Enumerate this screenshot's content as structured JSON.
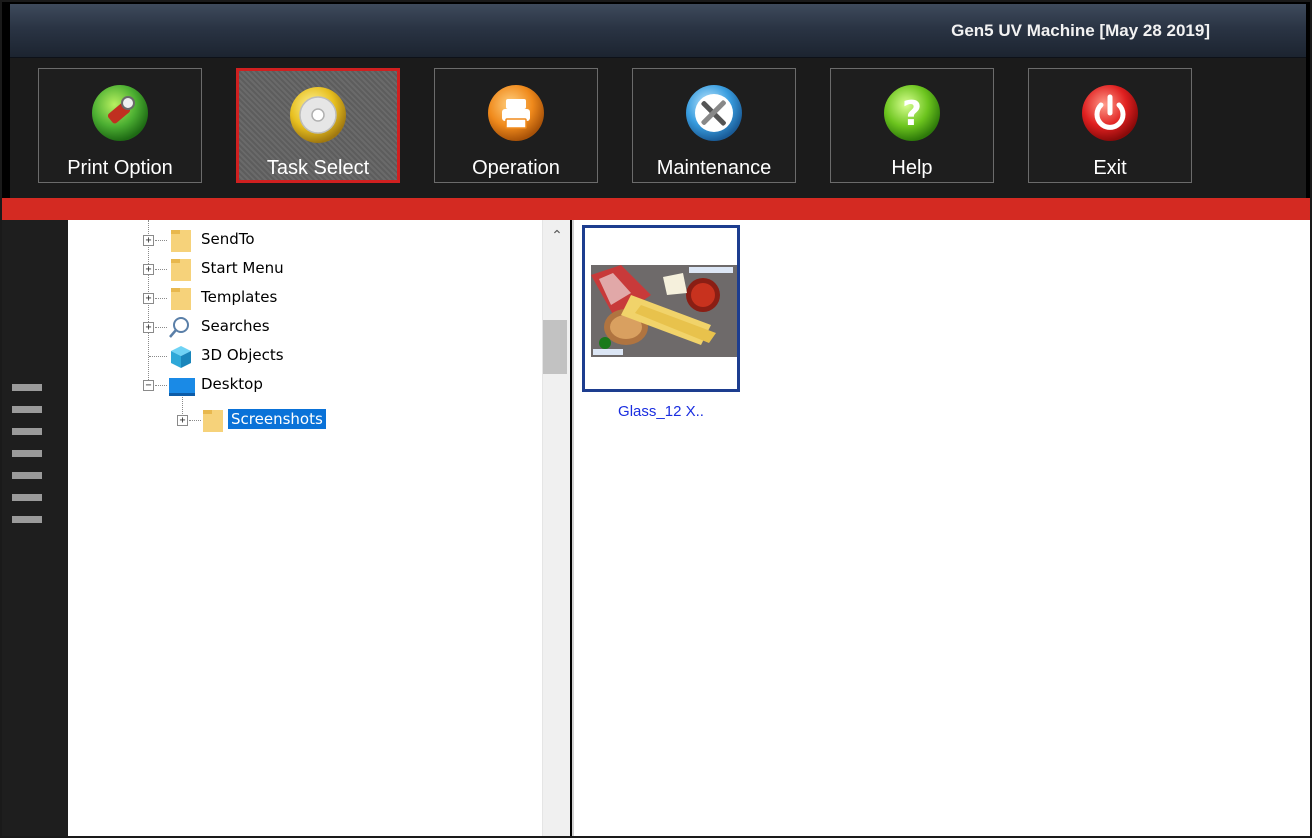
{
  "window": {
    "title": "Gen5 UV Machine [May 28 2019]"
  },
  "toolbar": {
    "buttons": [
      {
        "label": "Print Option",
        "icon": "print-option-icon",
        "active": false,
        "color": "#4caf32"
      },
      {
        "label": "Task Select",
        "icon": "disc-icon",
        "active": true,
        "color": "#e8c020"
      },
      {
        "label": "Operation",
        "icon": "printer-icon",
        "active": false,
        "color": "#f08a1c"
      },
      {
        "label": "Maintenance",
        "icon": "tools-icon",
        "active": false,
        "color": "#3a9ee0"
      },
      {
        "label": "Help",
        "icon": "help-icon",
        "active": false,
        "color": "#6cc41e"
      },
      {
        "label": "Exit",
        "icon": "power-icon",
        "active": false,
        "color": "#e02020"
      }
    ]
  },
  "tree": {
    "items": [
      {
        "label": "SendTo",
        "icon": "folder-icon",
        "expander": "+"
      },
      {
        "label": "Start Menu",
        "icon": "folder-icon",
        "expander": "+"
      },
      {
        "label": "Templates",
        "icon": "folder-icon",
        "expander": "+"
      },
      {
        "label": "Searches",
        "icon": "search-icon",
        "expander": "+"
      },
      {
        "label": "3D Objects",
        "icon": "3d-objects-icon",
        "expander": ""
      },
      {
        "label": "Desktop",
        "icon": "desktop-icon",
        "expander": "−"
      },
      {
        "label": "Screenshots",
        "icon": "folder-icon",
        "expander": "+",
        "selected": true
      }
    ]
  },
  "files": {
    "items": [
      {
        "label": "Glass_12 X..",
        "selected": true
      }
    ]
  },
  "colors": {
    "accent_red": "#d42a22",
    "selection_blue": "#0a72d8",
    "file_label_blue": "#1a2ee0"
  }
}
